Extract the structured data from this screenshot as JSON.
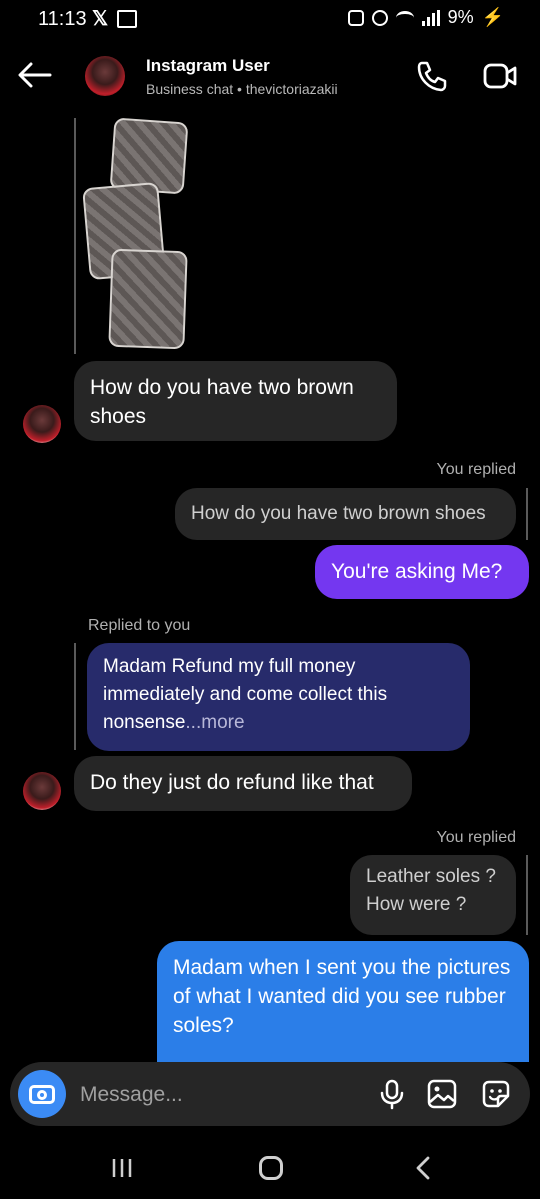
{
  "status": {
    "time": "11:13",
    "battery": "9%"
  },
  "header": {
    "title": "Instagram User",
    "subtitle": "Business chat • thevictoriazakii"
  },
  "messages": {
    "m1": "How do you have two brown shoes",
    "you_replied_1": "You replied",
    "quote1": "How do you have two brown shoes",
    "m2": "You're asking Me?",
    "replied_to_you": "Replied to you",
    "quote2": "Madam Refund my full money immediately and come collect this nonsense",
    "quote2_more": "...more",
    "m3": "Do they just do refund like that",
    "you_replied_2": "You replied",
    "quote3_line1": "Leather soles ?",
    "quote3_line2": "How were ?",
    "m4": "Madam when I sent you the pictures of what I wanted did you see rubber soles?"
  },
  "composer": {
    "placeholder": "Message..."
  }
}
